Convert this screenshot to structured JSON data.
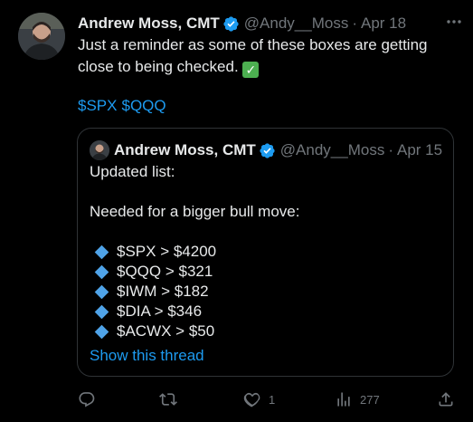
{
  "tweet": {
    "author_name": "Andrew Moss, CMT",
    "author_handle": "@Andy__Moss",
    "separator": "·",
    "date": "Apr 18",
    "text_line1": "Just a reminder as some of these boxes are getting",
    "text_line2": "close to being checked.",
    "check_emoji": "✓",
    "cashtags": [
      "$SPX",
      "$QQQ"
    ]
  },
  "quote": {
    "author_name": "Andrew Moss, CMT",
    "author_handle": "@Andy__Moss",
    "separator": "·",
    "date": "Apr 15",
    "line1": "Updated list:",
    "line2": "Needed for a bigger bull move:",
    "bullets": [
      "$SPX > $4200",
      "$QQQ > $321",
      "$IWM > $182",
      "$DIA > $346",
      "$ACWX > $50"
    ],
    "show_thread": "Show this thread"
  },
  "actions": {
    "reply_count": "",
    "retweet_count": "",
    "like_count": "1",
    "views_count": "277"
  },
  "colors": {
    "background": "#000000",
    "text": "#e7e9ea",
    "muted": "#71767b",
    "link": "#1d9bf0",
    "verified": "#1d9bf0",
    "checkmark_emoji_bg": "#4caf50",
    "diamond": "#4fa3e8"
  },
  "icons": [
    "verified-badge-icon",
    "more-icon",
    "reply-icon",
    "retweet-icon",
    "like-icon",
    "views-icon",
    "share-icon"
  ]
}
